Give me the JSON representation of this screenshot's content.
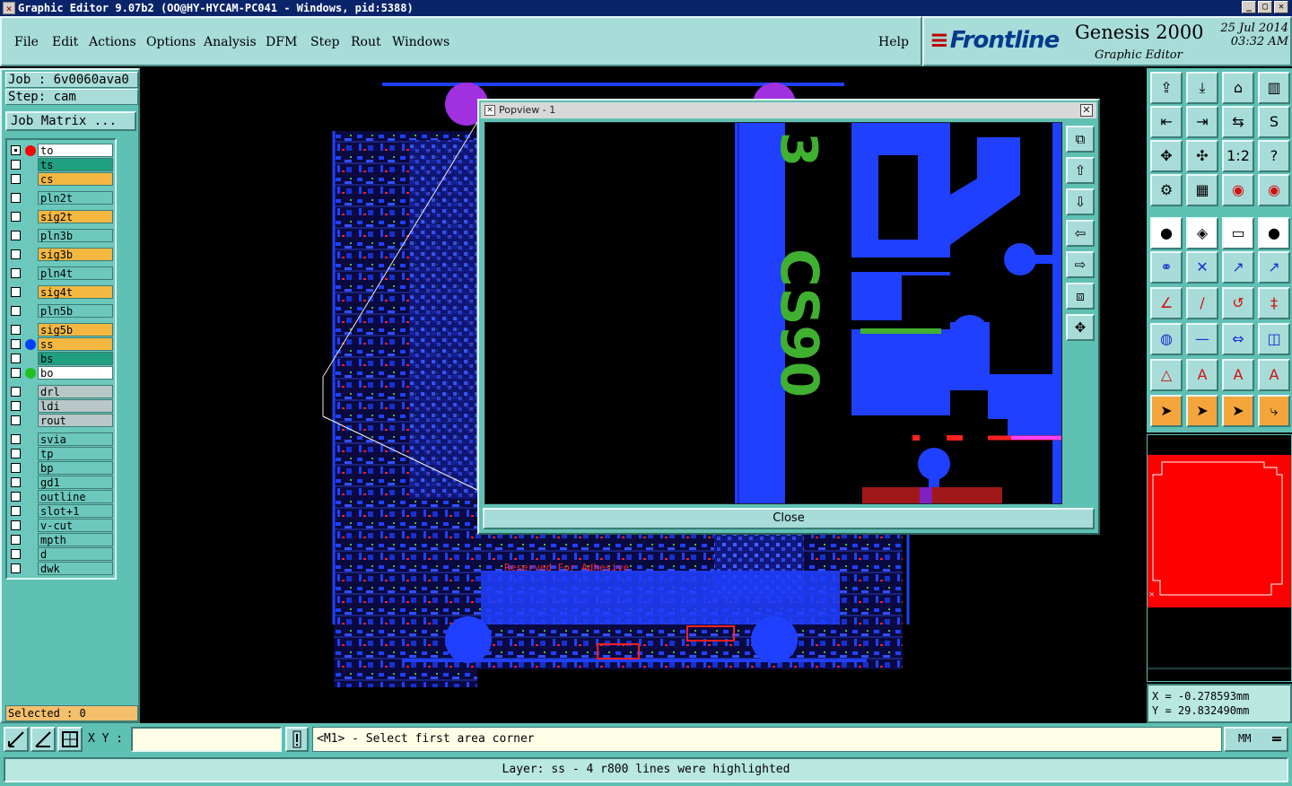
{
  "window": {
    "title": "Graphic Editor 9.07b2 (OO@HY-HYCAM-PC041 - Windows, pid:5388)"
  },
  "menu": {
    "items": [
      "File",
      "Edit",
      "Actions",
      "Options",
      "Analysis",
      "DFM",
      "Step",
      "Rout",
      "Windows"
    ],
    "help": "Help"
  },
  "logo": {
    "brand": "Frontline",
    "product": "Genesis 2000",
    "subtitle": "Graphic Editor",
    "date": "25 Jul 2014",
    "time": "03:32 AM"
  },
  "job": {
    "job_label": "Job : 6v0060ava0",
    "step_label": "Step: cam",
    "matrix_button": "Job Matrix ..."
  },
  "layers": [
    {
      "name": "to",
      "color": "#ffffff",
      "dot": "#ff0000",
      "checked": true
    },
    {
      "name": "ts",
      "color": "#20a080",
      "dot": "",
      "checked": false
    },
    {
      "name": "cs",
      "color": "#f4b840",
      "dot": "",
      "checked": false
    },
    {
      "name": "pln2t",
      "color": "#6cc8bc",
      "dot": "",
      "checked": false
    },
    {
      "name": "sig2t",
      "color": "#f4b840",
      "dot": "",
      "checked": false
    },
    {
      "name": "pln3b",
      "color": "#6cc8bc",
      "dot": "",
      "checked": false
    },
    {
      "name": "sig3b",
      "color": "#f4b840",
      "dot": "",
      "checked": false
    },
    {
      "name": "pln4t",
      "color": "#6cc8bc",
      "dot": "",
      "checked": false
    },
    {
      "name": "sig4t",
      "color": "#f4b840",
      "dot": "",
      "checked": false
    },
    {
      "name": "pln5b",
      "color": "#6cc8bc",
      "dot": "",
      "checked": false
    },
    {
      "name": "sig5b",
      "color": "#f4b840",
      "dot": "",
      "checked": false
    },
    {
      "name": "ss",
      "color": "#f4b840",
      "dot": "#0040ff",
      "checked": false
    },
    {
      "name": "bs",
      "color": "#20a080",
      "dot": "",
      "checked": false
    },
    {
      "name": "bo",
      "color": "#ffffff",
      "dot": "#20c020",
      "checked": false
    },
    {
      "name": "drl",
      "color": "#b8c8c8",
      "dot": "",
      "checked": false
    },
    {
      "name": "ldi",
      "color": "#b8c8c8",
      "dot": "",
      "checked": false
    },
    {
      "name": "rout",
      "color": "#b8c8c8",
      "dot": "",
      "checked": false
    },
    {
      "name": "svia",
      "color": "#6cc8bc",
      "dot": "",
      "checked": false
    },
    {
      "name": "tp",
      "color": "#6cc8bc",
      "dot": "",
      "checked": false
    },
    {
      "name": "bp",
      "color": "#6cc8bc",
      "dot": "",
      "checked": false
    },
    {
      "name": "gd1",
      "color": "#6cc8bc",
      "dot": "",
      "checked": false
    },
    {
      "name": "outline",
      "color": "#6cc8bc",
      "dot": "",
      "checked": false
    },
    {
      "name": "slot+1",
      "color": "#6cc8bc",
      "dot": "",
      "checked": false
    },
    {
      "name": "v-cut",
      "color": "#6cc8bc",
      "dot": "",
      "checked": false
    },
    {
      "name": "mpth",
      "color": "#6cc8bc",
      "dot": "",
      "checked": false
    },
    {
      "name": "d",
      "color": "#6cc8bc",
      "dot": "",
      "checked": false
    },
    {
      "name": "dwk",
      "color": "#6cc8bc",
      "dot": "",
      "checked": false
    }
  ],
  "selected_label": "Selected : 0",
  "board": {
    "annotation": "Reserved For Adhesive"
  },
  "popview": {
    "title": "Popview - 1",
    "close_label": "Close",
    "text_a": "CS90",
    "text_b": "3"
  },
  "coords": {
    "x": "X = -0.278593mm",
    "y": "Y = 29.832490mm"
  },
  "bottom": {
    "xy_label": "X Y :",
    "xy_value": "",
    "prompt": "<M1> - Select first area corner",
    "units": "MM"
  },
  "status": "Layer: ss - 4 r800 lines were highlighted"
}
